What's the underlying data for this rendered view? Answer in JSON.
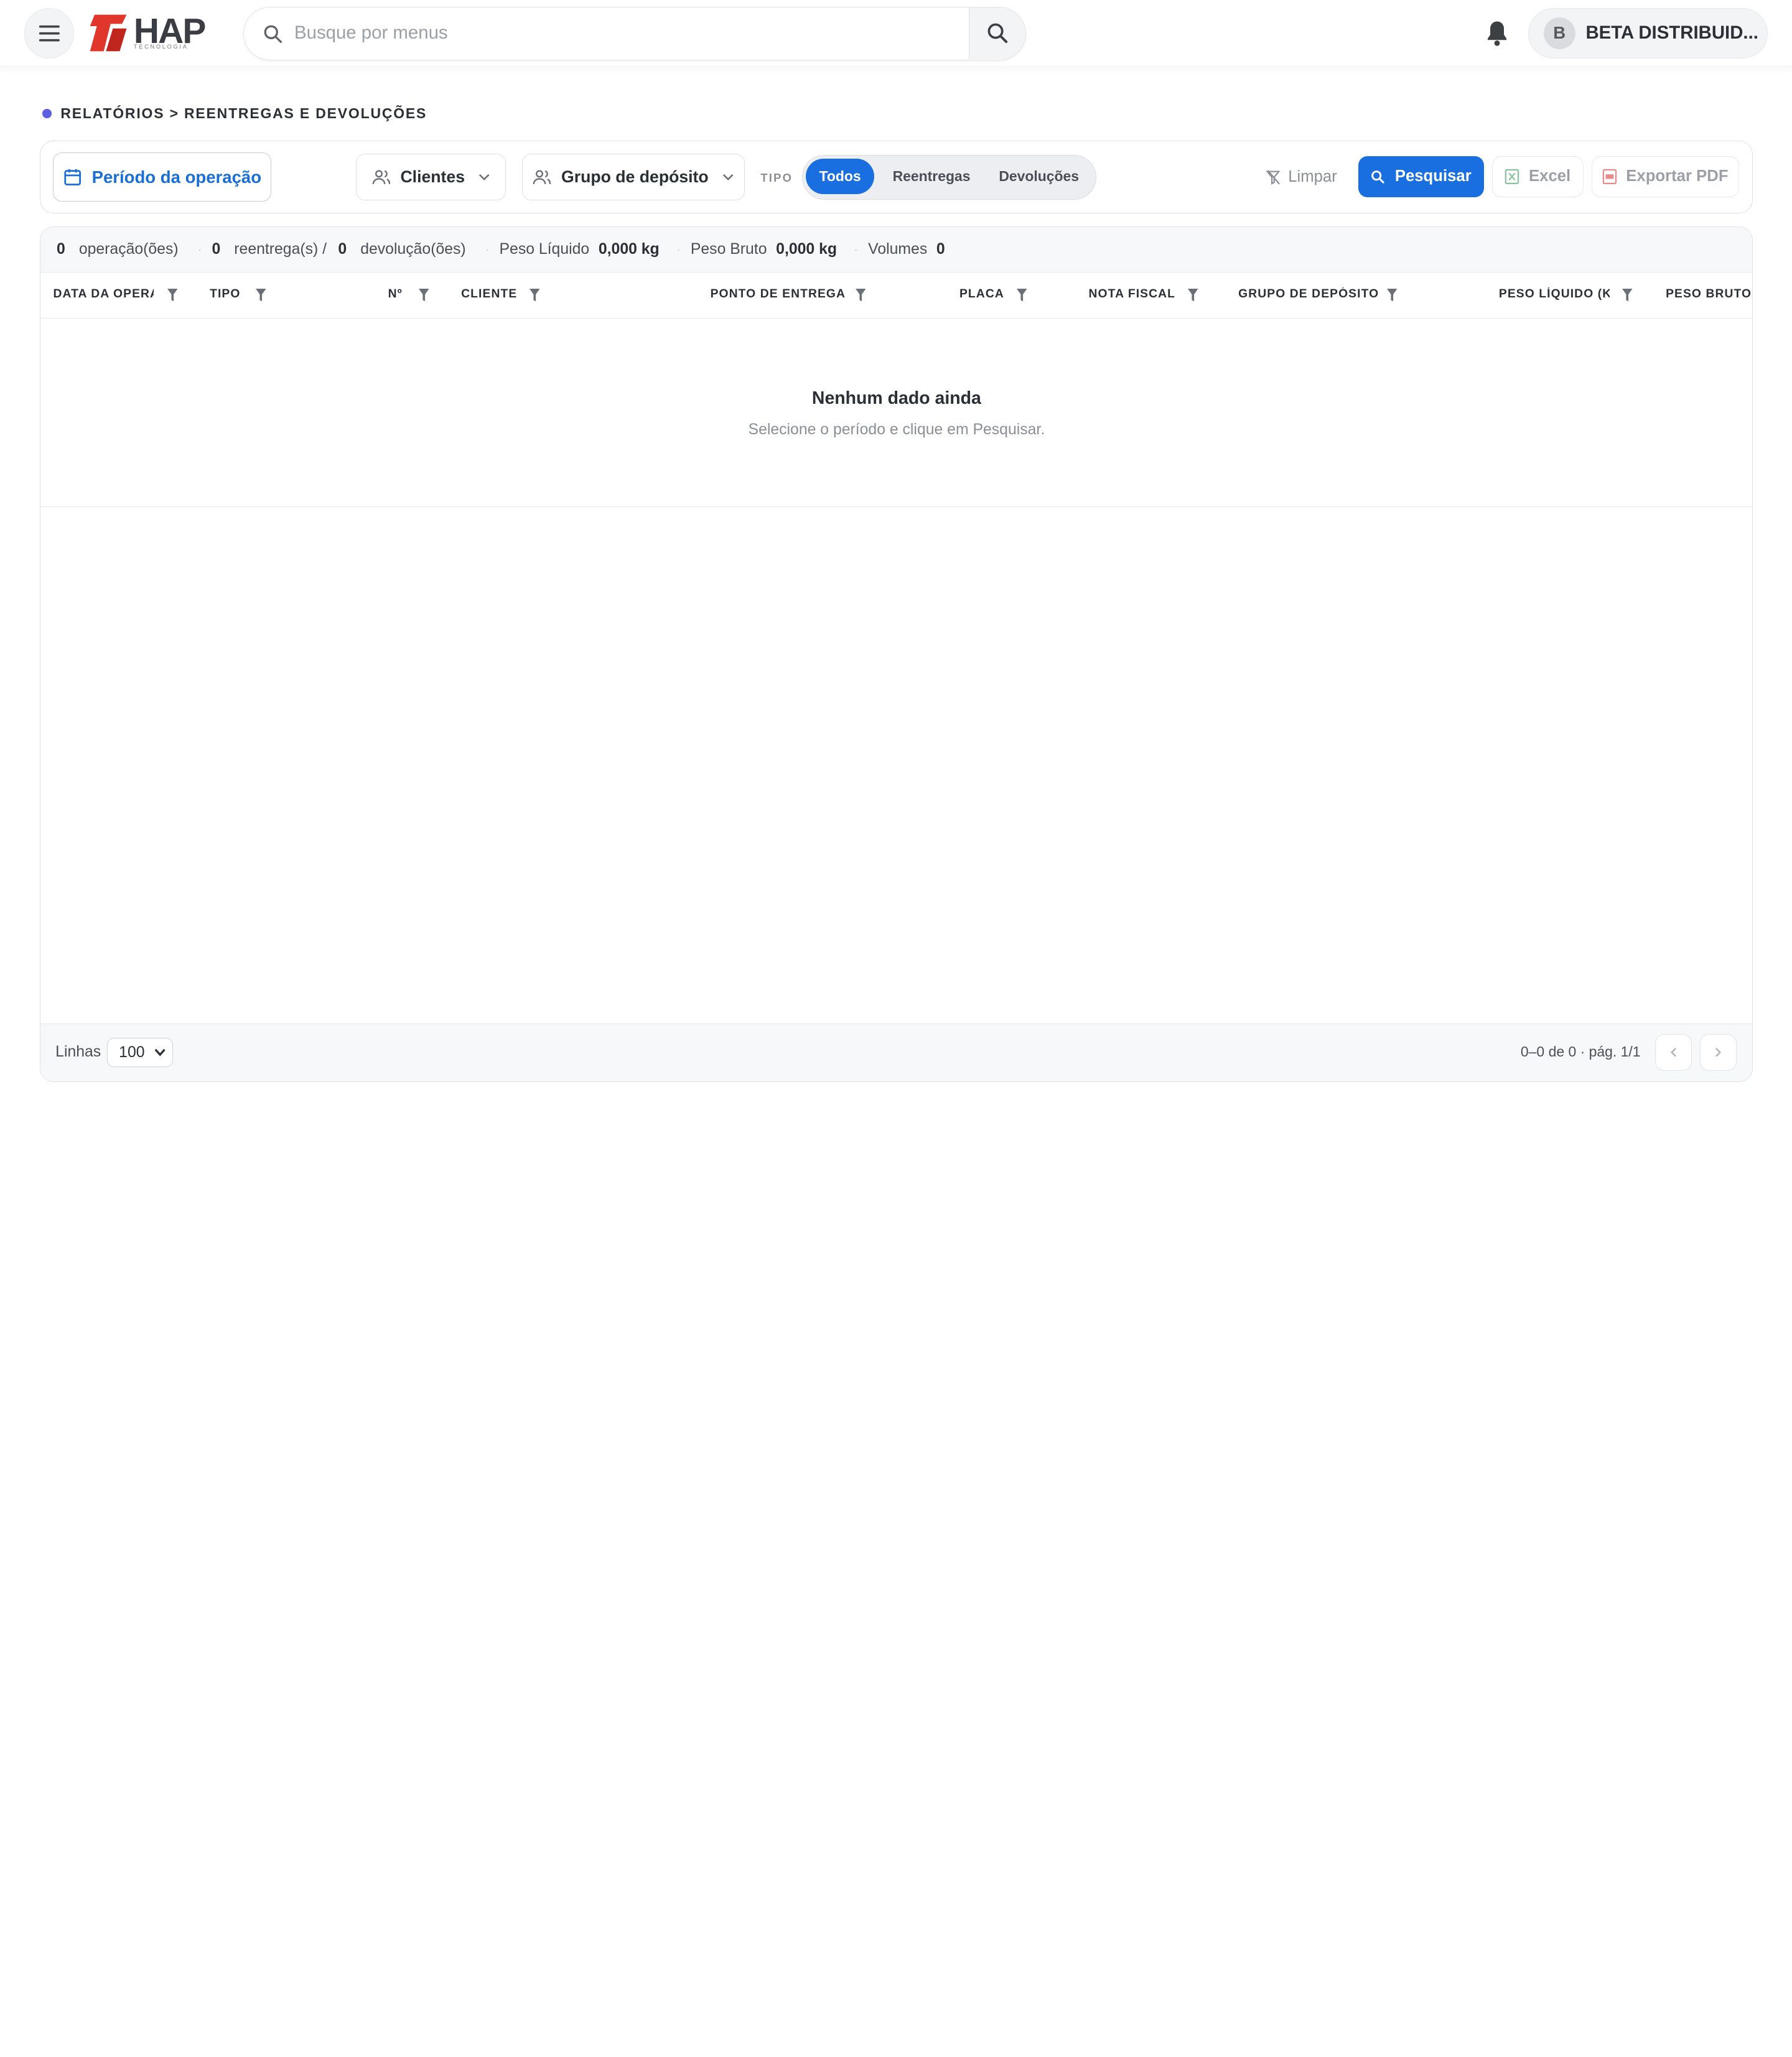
{
  "header": {
    "search_placeholder": "Busque por menus",
    "brand": "HAP",
    "brand_sub": "TECNOLOGIA",
    "user_initial": "B",
    "user_name": "BETA DISTRIBUID..."
  },
  "breadcrumb": "RELATÓRIOS > REENTREGAS E DEVOLUÇÕES",
  "filters": {
    "periodo": "Período da operação",
    "clientes": "Clientes",
    "grupo": "Grupo de depósito",
    "tipo_label": "TIPO",
    "tipo_options": [
      "Todos",
      "Reentregas",
      "Devoluções"
    ],
    "tipo_selected": "Todos",
    "limpar": "Limpar",
    "pesquisar": "Pesquisar",
    "excel": "Excel",
    "pdf": "Exportar PDF"
  },
  "summary": {
    "operacoes_count": "0",
    "operacoes_label": "operação(ões)",
    "reentregas_count": "0",
    "reentregas_label": "reentrega(s) /",
    "devolucoes_count": "0",
    "devolucoes_label": "devolução(ões)",
    "peso_liquido_label": "Peso Líquido",
    "peso_liquido_value": "0,000 kg",
    "peso_bruto_label": "Peso Bruto",
    "peso_bruto_value": "0,000 kg",
    "volumes_label": "Volumes",
    "volumes_value": "0"
  },
  "table": {
    "columns": [
      "DATA DA OPERAÇÃO",
      "TIPO",
      "Nº",
      "CLIENTE",
      "PONTO DE ENTREGA",
      "PLACA",
      "NOTA FISCAL",
      "GRUPO DE DEPÓSITO",
      "PESO LÍQUIDO (KG)",
      "PESO BRUTO"
    ],
    "empty_title": "Nenhum dado ainda",
    "empty_sub": "Selecione o período e clique em Pesquisar."
  },
  "footer": {
    "linhas_label": "Linhas",
    "linhas_value": "100",
    "page_info": "0–0 de 0 · pág. 1/1"
  },
  "colors": {
    "primary": "#1a6fe0",
    "crumb_dot": "#5b5fe0",
    "logo_red": "#e0362b"
  }
}
